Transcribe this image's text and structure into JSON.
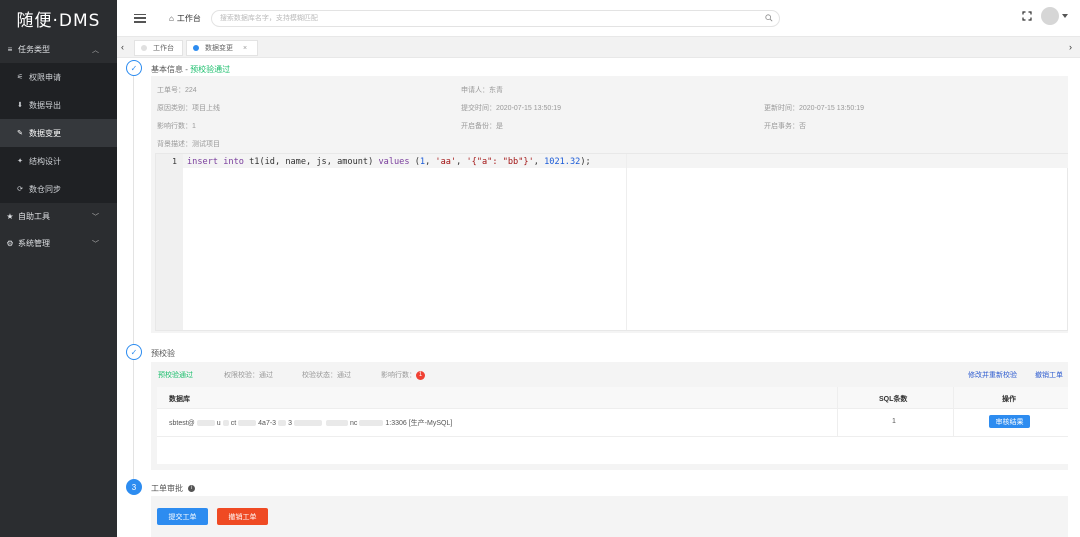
{
  "app": {
    "logo": "随便·DMS"
  },
  "sidebar": {
    "groups": [
      {
        "label": "任务类型",
        "icon": "list-icon",
        "expanded": true
      },
      {
        "label": "自助工具",
        "icon": "star-icon",
        "expanded": false
      },
      {
        "label": "系统管理",
        "icon": "gear-icon",
        "expanded": false
      }
    ],
    "items": [
      {
        "label": "权限申请",
        "icon": "filter-icon"
      },
      {
        "label": "数据导出",
        "icon": "download-icon"
      },
      {
        "label": "数据变更",
        "icon": "edit-icon",
        "active": true
      },
      {
        "label": "结构设计",
        "icon": "structure-icon"
      },
      {
        "label": "数仓同步",
        "icon": "sync-icon"
      }
    ]
  },
  "topbar": {
    "breadcrumb": "工作台",
    "search_placeholder": "搜索数据库名字，支持模糊匹配"
  },
  "tabs": [
    {
      "label": "工作台",
      "dot_color": "#e0e0e0"
    },
    {
      "label": "数据变更",
      "dot_color": "#2d8cf0",
      "active": true
    }
  ],
  "basic": {
    "title": "基本信息 - ",
    "status": "预校验通过",
    "ticket_label": "工单号：",
    "ticket_no": "224",
    "applicant_label": "申请人：",
    "applicant": "东青",
    "reason_label": "原因类别：",
    "reason": "项目上线",
    "submit_label": "提交时间：",
    "submit_time": "2020-07-15 13:50:19",
    "update_label": "更新时间：",
    "update_time": "2020-07-15 13:50:19",
    "affected_label": "影响行数：",
    "affected": "1",
    "backup_label": "开启备份：",
    "backup": "是",
    "tx_label": "开启事务：",
    "tx": "否",
    "desc_label": "背景描述：",
    "desc": "测试项目"
  },
  "editor": {
    "line_no": "1",
    "kw1": "insert",
    "kw2": "into",
    "tbl": " t1(id, name, js, amount) ",
    "kw3": "values",
    "open": " (",
    "n1": "1",
    "comma": ", ",
    "s1": "'aa'",
    "s2": "'{\"a\": \"bb\"}'",
    "n2": "1021.32",
    "close": ");"
  },
  "precheck": {
    "title": "预校验",
    "passed": "预校验通过",
    "perm_label": "权限校验：",
    "perm": "通过",
    "status_label": "校验状态：",
    "status": "通过",
    "rows_label": "影响行数：",
    "rows": "1",
    "relink": "修改并重新校验",
    "cancel_link": "撤销工单",
    "col_db": "数据库",
    "col_sql": "SQL条数",
    "col_op": "操作",
    "db_prefix": "sbtest@",
    "db_mid1": "u",
    "db_mid2": "ct",
    "db_mid3": "4a7-3",
    "db_mid4": "3",
    "db_mid5": "nc",
    "db_suffix": "1:3306 [生产-MySQL]",
    "sql_count": "1",
    "result_btn": "审核结果"
  },
  "approval": {
    "step": "3",
    "title": "工单审批",
    "submit_btn": "提交工单",
    "cancel_btn": "撤销工单"
  },
  "colors": {
    "primary": "#2d8cf0",
    "success": "#19be6b",
    "danger": "#f04134",
    "cancel_btn": "#ef4a23",
    "sidebar": "#2b2d30"
  }
}
